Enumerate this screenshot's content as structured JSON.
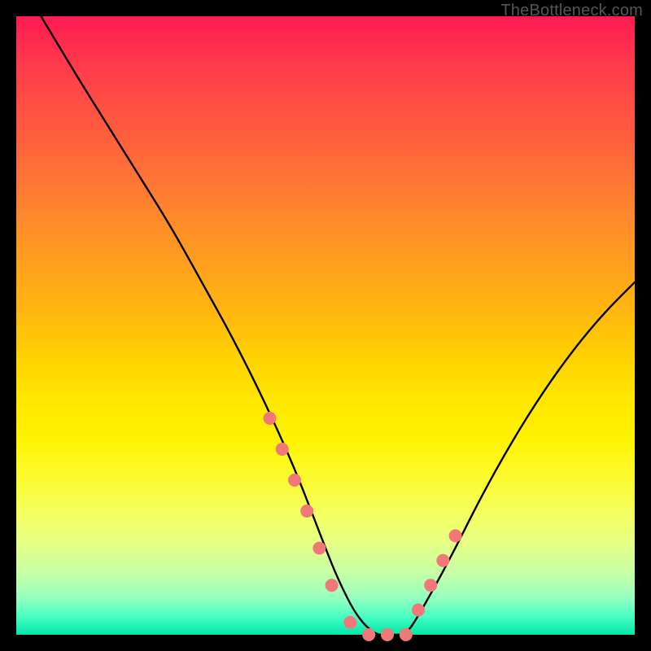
{
  "watermark": "TheBottleneck.com",
  "chart_data": {
    "type": "line",
    "title": "",
    "xlabel": "",
    "ylabel": "",
    "xlim": [
      0,
      100
    ],
    "ylim": [
      0,
      100
    ],
    "grid": false,
    "series": [
      {
        "name": "bottleneck-curve",
        "x": [
          4,
          10,
          15,
          20,
          25,
          30,
          35,
          40,
          45,
          50,
          52,
          55,
          58,
          60,
          63,
          65,
          70,
          75,
          80,
          85,
          90,
          95,
          100
        ],
        "values": [
          100,
          90,
          82,
          74,
          66,
          57,
          48,
          38,
          27,
          14,
          9,
          3,
          0,
          0,
          0,
          3,
          12,
          22,
          31,
          39,
          46,
          52,
          57
        ]
      }
    ],
    "markers": {
      "name": "highlight-points",
      "color": "#f07878",
      "x": [
        41,
        43,
        45,
        47,
        49,
        51,
        54,
        57,
        60,
        63,
        65,
        67,
        69,
        71
      ],
      "values": [
        35,
        30,
        25,
        20,
        14,
        8,
        2,
        0,
        0,
        0,
        4,
        8,
        12,
        16
      ]
    }
  }
}
